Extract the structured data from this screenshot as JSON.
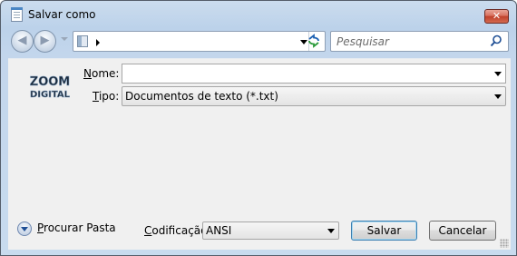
{
  "window": {
    "title": "Salvar como",
    "close_label": "✕"
  },
  "nav": {
    "address_value": "",
    "search_placeholder": "Pesquisar"
  },
  "form": {
    "filename_label_accel": "N",
    "filename_label_rest": "ome:",
    "filename_value": "",
    "type_label_accel": "T",
    "type_label_rest": "ipo:",
    "type_value": "Documentos de texto (*.txt)"
  },
  "footer": {
    "browse_accel": "P",
    "browse_rest": "rocurar Pasta",
    "encoding_label_accel": "C",
    "encoding_label_rest": "odificação:",
    "encoding_value": "ANSI",
    "save_label": "Salvar",
    "cancel_label": "Cancelar"
  },
  "logo": {
    "line1": "ZOOM",
    "line2": "DIGITAL"
  },
  "colors": {
    "frame": "#bcd2ea",
    "panel": "#f0f0f0",
    "close": "#c0402a",
    "accent": "#3c7fb1"
  }
}
